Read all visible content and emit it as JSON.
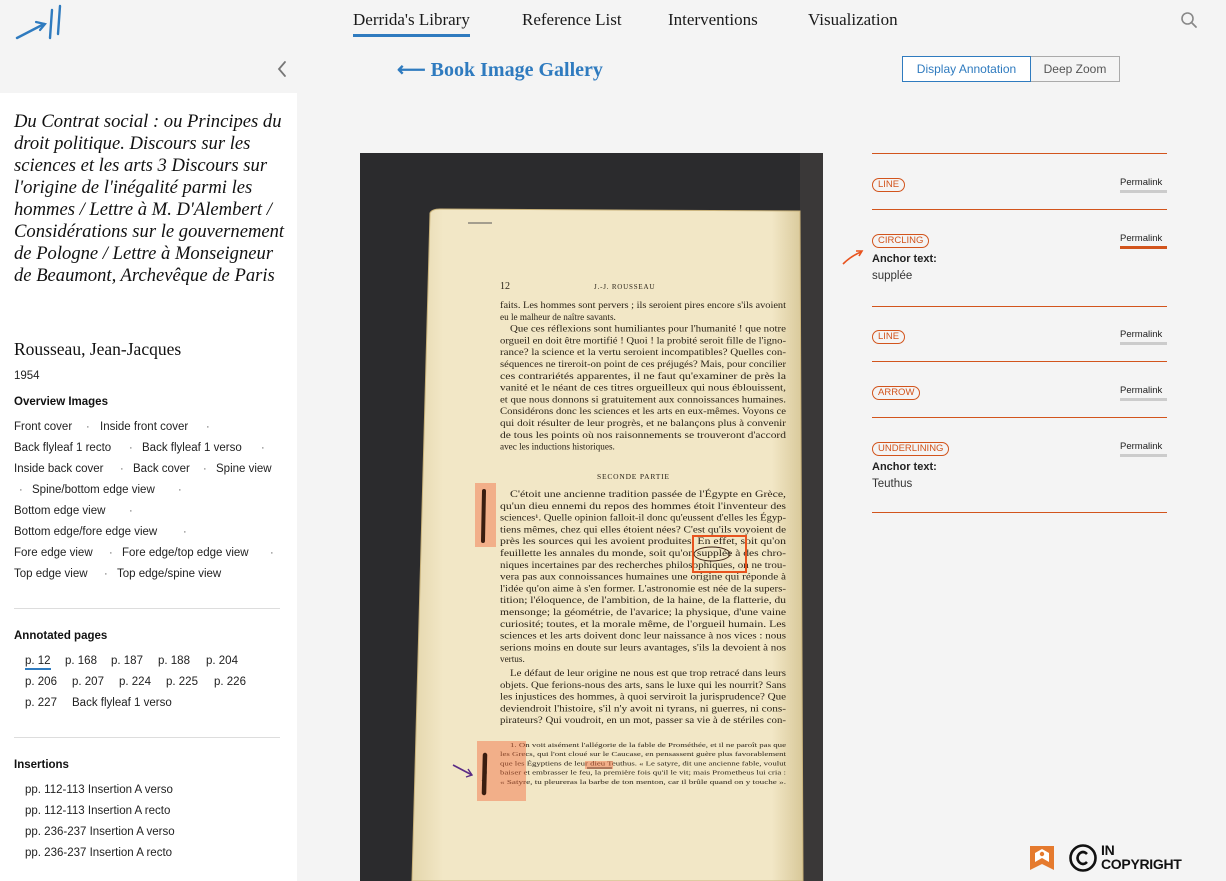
{
  "nav": {
    "items": [
      "Derrida's Library",
      "Reference List",
      "Interventions",
      "Visualization"
    ],
    "active": 0
  },
  "toolbar": {
    "back_label": "⟵ Book Image Gallery",
    "display_annotation": "Display Annotation",
    "deep_zoom": "Deep Zoom"
  },
  "book": {
    "title": "Du Contrat social : ou Principes du droit politique. Discours sur les sciences et les arts 3 Discours sur l'origine de l'inégalité parmi les hommes / Lettre à M. D'Alembert / Considérations sur le gouvernement de Pologne / Lettre à Monseigneur de Beaumont, Archevêque de Paris",
    "author": "Rousseau, Jean-Jacques",
    "year": "1954"
  },
  "overview": {
    "heading": "Overview Images",
    "items": [
      "Front cover",
      "Inside front cover",
      "Back flyleaf 1 recto",
      "Back flyleaf 1 verso",
      "Inside back cover",
      "Back cover",
      "Spine view",
      "Spine/bottom edge view",
      "Bottom edge view",
      "Bottom edge/fore edge view",
      "Fore edge view",
      "Fore edge/top edge view",
      "Top edge view",
      "Top edge/spine view"
    ]
  },
  "annotated": {
    "heading": "Annotated pages",
    "items": [
      "p. 12",
      "p. 168",
      "p. 187",
      "p. 188",
      "p. 204",
      "p. 206",
      "p. 207",
      "p. 224",
      "p. 225",
      "p. 226",
      "p. 227",
      "Back flyleaf 1 verso"
    ],
    "selected": 0
  },
  "insertions": {
    "heading": "Insertions",
    "items": [
      "pp. 112-113 Insertion A verso",
      "pp. 112-113 Insertion A recto",
      "pp. 236-237 Insertion A verso",
      "pp. 236-237 Insertion A recto"
    ]
  },
  "page": {
    "number": "12",
    "header": "J.-J. ROUSSEAU",
    "section": "SECONDE PARTIE",
    "para1": [
      "faits. Les hommes sont pervers ; ils seroient pires encore s'ils avoient",
      "eu le malheur de naître savants.",
      "Que ces réflexions sont humiliantes pour l'humanité ! que notre",
      "orgueil en doit être mortifié ! Quoi ! la probité seroit fille de l'igno-",
      "rance? la science et la vertu seroient incompatibles? Quelles con-",
      "séquences ne tireroit-on point de ces préjugés? Mais, pour concilier",
      "ces contrariétés apparentes, il ne faut qu'examiner de près la",
      "vanité et le néant de ces titres orgueilleux qui nous éblouissent,",
      "et que nous donnons si gratuitement aux connoissances humaines.",
      "Considérons donc les sciences et les arts en eux-mêmes. Voyons ce",
      "qui doit résulter de leur progrès, et ne balançons plus à convenir",
      "de tous les points où nos raisonnements se trouveront d'accord",
      "avec les inductions historiques."
    ],
    "para2": [
      "C'étoit une ancienne tradition passée de l'Égypte en Grèce,",
      "qu'un dieu ennemi du repos des hommes étoit l'inventeur des",
      "sciences¹. Quelle opinion falloit-il donc qu'eussent d'elles les Égyp-",
      "tiens mêmes, chez qui elles étoient nées? C'est qu'ils voyoient de",
      "près les sources qui les avoient produites. En effet, soit qu'on",
      "feuillette les annales du monde, soit qu'on supplée à des chro-",
      "niques incertaines par des recherches philosophiques, on ne trou-",
      "vera pas aux connoissances humaines une origine qui réponde à",
      "l'idée qu'on aime à s'en former. L'astronomie est née de la supers-",
      "tition; l'éloquence, de l'ambition, de la haine, de la flatterie, du",
      "mensonge; la géométrie, de l'avarice; la physique, d'une vaine",
      "curiosité; toutes, et la morale même, de l'orgueil humain. Les",
      "sciences et les arts doivent donc leur naissance à nos vices : nous",
      "serions moins en doute sur leurs avantages, s'ils la devoient à nos",
      "vertus."
    ],
    "para3": [
      "Le défaut de leur origine ne nous est que trop retracé dans leurs",
      "objets. Que ferions-nous des arts, sans le luxe qui les nourrit? Sans",
      "les injustices des hommes, à quoi serviroit la jurisprudence? Que",
      "deviendroit l'histoire, s'il n'y avoit ni tyrans, ni guerres, ni cons-",
      "pirateurs? Qui voudroit, en un mot, passer sa vie à de stériles con-"
    ],
    "footnote": [
      "1. On voit aisément l'allégorie de la fable de Prométhée, et il ne paroît pas que",
      "les Grecs, qui l'ont cloué sur le Caucase, en pensassent guère plus favorablement",
      "que les Égyptiens de leur dieu Teuthus. « Le satyre, dit une ancienne fable, voulut",
      "baiser et embrasser le feu, la première fois qu'il le vit; mais Prometheus lui cria :",
      "« Satyre, tu pleureras la barbe de ton menton, car il brûle quand on y touche »."
    ]
  },
  "annotations": [
    {
      "type": "LINE",
      "permalink": "Permalink",
      "anchor_label": "",
      "anchor_text": ""
    },
    {
      "type": "CIRCLING",
      "permalink": "Permalink",
      "anchor_label": "Anchor text:",
      "anchor_text": "supplée"
    },
    {
      "type": "LINE",
      "permalink": "Permalink",
      "anchor_label": "",
      "anchor_text": ""
    },
    {
      "type": "ARROW",
      "permalink": "Permalink",
      "anchor_label": "",
      "anchor_text": ""
    },
    {
      "type": "UNDERLINING",
      "permalink": "Permalink",
      "anchor_label": "Anchor text:",
      "anchor_text": "Teuthus"
    }
  ],
  "license": {
    "line1": "IN",
    "line2": "COPYRIGHT"
  },
  "colors": {
    "accent_blue": "#2f7bbf",
    "annotation_orange": "#d2541c",
    "page_paper": "#f1e6c4",
    "scan_background": "#2b2b2d"
  },
  "icons": {
    "logo": "derrida-logo-icon",
    "search": "search-icon",
    "collapse": "chevron-left-icon",
    "license_badge": "rights-badge-icon",
    "copyright": "copyright-icon",
    "pointer": "arrow-pointer-icon"
  }
}
